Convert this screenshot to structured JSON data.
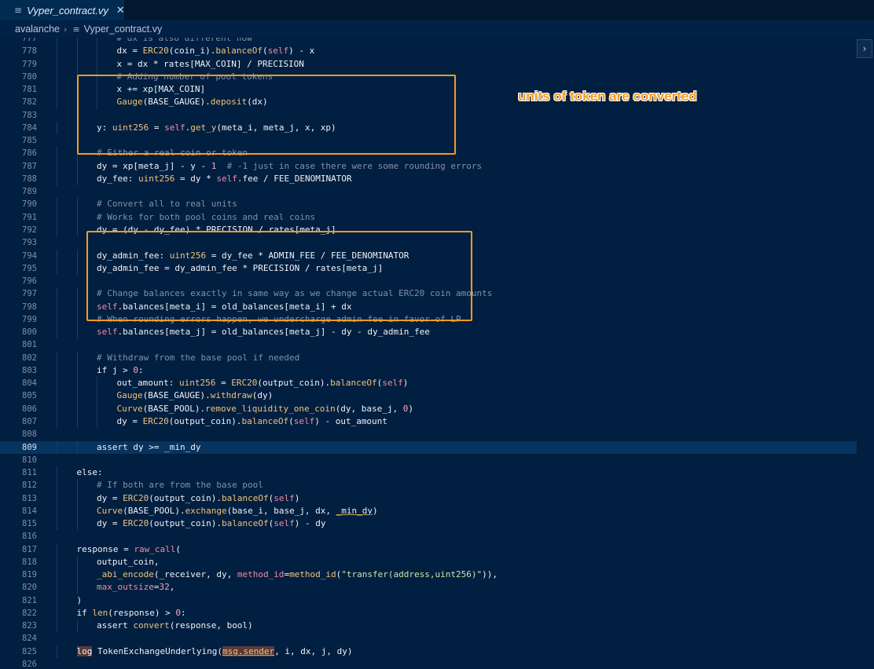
{
  "tab": {
    "icon": "≡",
    "label": "Vyper_contract.vy",
    "close": "✕"
  },
  "breadcrumb": {
    "folder": "avalanche",
    "separator": "›",
    "icon": "≡",
    "file": "Vyper_contract.vy"
  },
  "annotation": {
    "text": "units of token are converted"
  },
  "scroll_button": {
    "label": "›"
  },
  "code_lines": [
    {
      "n": "777",
      "i": 3,
      "segs": [
        [
          "c",
          "# dx is also different now"
        ]
      ]
    },
    {
      "n": "778",
      "i": 3,
      "segs": [
        [
          "k",
          "dx = "
        ],
        [
          "f",
          "ERC20"
        ],
        [
          "k",
          "(coin_i)."
        ],
        [
          "f",
          "balanceOf"
        ],
        [
          "k",
          "("
        ],
        [
          "s",
          "self"
        ],
        [
          "k",
          ") "
        ],
        [
          "o",
          "-"
        ],
        [
          "k",
          " x"
        ]
      ]
    },
    {
      "n": "779",
      "i": 3,
      "segs": [
        [
          "k",
          "x = dx "
        ],
        [
          "o",
          "*"
        ],
        [
          "k",
          " rates[MAX_COIN] "
        ],
        [
          "o",
          "/"
        ],
        [
          "k",
          " PRECISION"
        ]
      ]
    },
    {
      "n": "780",
      "i": 3,
      "segs": [
        [
          "c",
          "# Adding number of pool tokens"
        ]
      ]
    },
    {
      "n": "781",
      "i": 3,
      "segs": [
        [
          "k",
          "x += xp[MAX_COIN]"
        ]
      ]
    },
    {
      "n": "782",
      "i": 3,
      "segs": [
        [
          "f",
          "Gauge"
        ],
        [
          "k",
          "(BASE_GAUGE)."
        ],
        [
          "f",
          "deposit"
        ],
        [
          "k",
          "(dx)"
        ]
      ]
    },
    {
      "n": "783",
      "i": 0,
      "segs": []
    },
    {
      "n": "784",
      "i": 2,
      "segs": [
        [
          "k",
          "y: "
        ],
        [
          "t",
          "uint256"
        ],
        [
          "k",
          " = "
        ],
        [
          "s",
          "self"
        ],
        [
          "k",
          "."
        ],
        [
          "f",
          "get_y"
        ],
        [
          "k",
          "(meta_i, meta_j, x, xp)"
        ]
      ]
    },
    {
      "n": "785",
      "i": 0,
      "segs": []
    },
    {
      "n": "786",
      "i": 2,
      "segs": [
        [
          "c",
          "# Either a real coin or token"
        ]
      ]
    },
    {
      "n": "787",
      "i": 2,
      "segs": [
        [
          "k",
          "dy = xp[meta_j] "
        ],
        [
          "o",
          "-"
        ],
        [
          "k",
          " y "
        ],
        [
          "o",
          "-"
        ],
        [
          "k",
          " "
        ],
        [
          "n",
          "1"
        ],
        [
          "k",
          "  "
        ],
        [
          "c",
          "# -1 just in case there were some rounding errors"
        ]
      ]
    },
    {
      "n": "788",
      "i": 2,
      "segs": [
        [
          "k",
          "dy_fee: "
        ],
        [
          "t",
          "uint256"
        ],
        [
          "k",
          " = dy "
        ],
        [
          "o",
          "*"
        ],
        [
          "k",
          " "
        ],
        [
          "s",
          "self"
        ],
        [
          "k",
          ".fee "
        ],
        [
          "o",
          "/"
        ],
        [
          "k",
          " FEE_DENOMINATOR"
        ]
      ]
    },
    {
      "n": "789",
      "i": 0,
      "segs": []
    },
    {
      "n": "790",
      "i": 2,
      "segs": [
        [
          "c",
          "# Convert all to real units"
        ]
      ]
    },
    {
      "n": "791",
      "i": 2,
      "segs": [
        [
          "c",
          "# Works for both pool coins and real coins"
        ]
      ]
    },
    {
      "n": "792",
      "i": 2,
      "segs": [
        [
          "k",
          "dy = (dy "
        ],
        [
          "o",
          "-"
        ],
        [
          "k",
          " dy_fee) "
        ],
        [
          "o",
          "*"
        ],
        [
          "k",
          " PRECISION "
        ],
        [
          "o",
          "/"
        ],
        [
          "k",
          " rates[meta_j]"
        ]
      ]
    },
    {
      "n": "793",
      "i": 0,
      "segs": []
    },
    {
      "n": "794",
      "i": 2,
      "segs": [
        [
          "k",
          "dy_admin_fee: "
        ],
        [
          "t",
          "uint256"
        ],
        [
          "k",
          " = dy_fee "
        ],
        [
          "o",
          "*"
        ],
        [
          "k",
          " ADMIN_FEE "
        ],
        [
          "o",
          "/"
        ],
        [
          "k",
          " FEE_DENOMINATOR"
        ]
      ]
    },
    {
      "n": "795",
      "i": 2,
      "segs": [
        [
          "k",
          "dy_admin_fee = dy_admin_fee "
        ],
        [
          "o",
          "*"
        ],
        [
          "k",
          " PRECISION "
        ],
        [
          "o",
          "/"
        ],
        [
          "k",
          " rates[meta_j]"
        ]
      ]
    },
    {
      "n": "796",
      "i": 0,
      "segs": []
    },
    {
      "n": "797",
      "i": 2,
      "segs": [
        [
          "c",
          "# Change balances exactly in same way as we change actual ERC20 coin amounts"
        ]
      ]
    },
    {
      "n": "798",
      "i": 2,
      "segs": [
        [
          "s",
          "self"
        ],
        [
          "k",
          ".balances[meta_i] = old_balances[meta_i] + dx"
        ]
      ]
    },
    {
      "n": "799",
      "i": 2,
      "segs": [
        [
          "c",
          "# When rounding errors happen, we undercharge admin fee in favor of LP"
        ]
      ]
    },
    {
      "n": "800",
      "i": 2,
      "segs": [
        [
          "s",
          "self"
        ],
        [
          "k",
          ".balances[meta_j] = old_balances[meta_j] "
        ],
        [
          "o",
          "-"
        ],
        [
          "k",
          " dy "
        ],
        [
          "o",
          "-"
        ],
        [
          "k",
          " dy_admin_fee"
        ]
      ]
    },
    {
      "n": "801",
      "i": 0,
      "segs": []
    },
    {
      "n": "802",
      "i": 2,
      "segs": [
        [
          "c",
          "# Withdraw from the base pool if needed"
        ]
      ]
    },
    {
      "n": "803",
      "i": 2,
      "segs": [
        [
          "k",
          "if j > "
        ],
        [
          "n",
          "0"
        ],
        [
          "k",
          ":"
        ]
      ]
    },
    {
      "n": "804",
      "i": 3,
      "segs": [
        [
          "k",
          "out_amount: "
        ],
        [
          "t",
          "uint256"
        ],
        [
          "k",
          " = "
        ],
        [
          "f",
          "ERC20"
        ],
        [
          "k",
          "(output_coin)."
        ],
        [
          "f",
          "balanceOf"
        ],
        [
          "k",
          "("
        ],
        [
          "s",
          "self"
        ],
        [
          "k",
          ")"
        ]
      ]
    },
    {
      "n": "805",
      "i": 3,
      "segs": [
        [
          "f",
          "Gauge"
        ],
        [
          "k",
          "(BASE_GAUGE)."
        ],
        [
          "f",
          "withdraw"
        ],
        [
          "k",
          "(dy)"
        ]
      ]
    },
    {
      "n": "806",
      "i": 3,
      "segs": [
        [
          "f",
          "Curve"
        ],
        [
          "k",
          "(BASE_POOL)."
        ],
        [
          "f",
          "remove_liquidity_one_coin"
        ],
        [
          "k",
          "(dy, base_j, "
        ],
        [
          "n",
          "0"
        ],
        [
          "k",
          ")"
        ]
      ]
    },
    {
      "n": "807",
      "i": 3,
      "segs": [
        [
          "k",
          "dy = "
        ],
        [
          "f",
          "ERC20"
        ],
        [
          "k",
          "(output_coin)."
        ],
        [
          "f",
          "balanceOf"
        ],
        [
          "k",
          "("
        ],
        [
          "s",
          "self"
        ],
        [
          "k",
          ") "
        ],
        [
          "o",
          "-"
        ],
        [
          "k",
          " out_amount"
        ]
      ]
    },
    {
      "n": "808",
      "i": 0,
      "segs": []
    },
    {
      "n": "809",
      "i": 2,
      "cur": true,
      "segs": [
        [
          "k",
          "assert dy >= _min_dy"
        ]
      ]
    },
    {
      "n": "810",
      "i": 0,
      "segs": []
    },
    {
      "n": "811",
      "i": 1,
      "segs": [
        [
          "k",
          "else:"
        ]
      ]
    },
    {
      "n": "812",
      "i": 2,
      "segs": [
        [
          "c",
          "# If both are from the base pool"
        ]
      ]
    },
    {
      "n": "813",
      "i": 2,
      "segs": [
        [
          "k",
          "dy = "
        ],
        [
          "f",
          "ERC20"
        ],
        [
          "k",
          "(output_coin)."
        ],
        [
          "f",
          "balanceOf"
        ],
        [
          "k",
          "("
        ],
        [
          "s",
          "self"
        ],
        [
          "k",
          ")"
        ]
      ]
    },
    {
      "n": "814",
      "i": 2,
      "segs": [
        [
          "f",
          "Curve"
        ],
        [
          "k",
          "(BASE_POOL)."
        ],
        [
          "f",
          "exchange"
        ],
        [
          "k",
          "(base_i, base_j, dx, "
        ],
        [
          "u",
          "_min_dy"
        ],
        [
          "k",
          ")"
        ]
      ]
    },
    {
      "n": "815",
      "i": 2,
      "segs": [
        [
          "k",
          "dy = "
        ],
        [
          "f",
          "ERC20"
        ],
        [
          "k",
          "(output_coin)."
        ],
        [
          "f",
          "balanceOf"
        ],
        [
          "k",
          "("
        ],
        [
          "s",
          "self"
        ],
        [
          "k",
          ") "
        ],
        [
          "o",
          "-"
        ],
        [
          "k",
          " dy"
        ]
      ]
    },
    {
      "n": "816",
      "i": 0,
      "segs": []
    },
    {
      "n": "817",
      "i": 1,
      "segs": [
        [
          "k",
          "response = "
        ],
        [
          "s",
          "raw_call"
        ],
        [
          "k",
          "("
        ]
      ]
    },
    {
      "n": "818",
      "i": 2,
      "segs": [
        [
          "k",
          "output_coin,"
        ]
      ]
    },
    {
      "n": "819",
      "i": 2,
      "segs": [
        [
          "f",
          "_abi_encode"
        ],
        [
          "k",
          "(_receiver, dy, "
        ],
        [
          "s",
          "method_id"
        ],
        [
          "k",
          "="
        ],
        [
          "f",
          "method_id"
        ],
        [
          "k",
          "("
        ],
        [
          "st",
          "\"transfer(address,uint256)\""
        ],
        [
          "k",
          ")),"
        ]
      ]
    },
    {
      "n": "820",
      "i": 2,
      "segs": [
        [
          "s",
          "max_outsize"
        ],
        [
          "k",
          "="
        ],
        [
          "n",
          "32"
        ],
        [
          "k",
          ","
        ]
      ]
    },
    {
      "n": "821",
      "i": 1,
      "segs": [
        [
          "k",
          ")"
        ]
      ]
    },
    {
      "n": "822",
      "i": 1,
      "segs": [
        [
          "k",
          "if "
        ],
        [
          "f",
          "len"
        ],
        [
          "k",
          "(response) > "
        ],
        [
          "n",
          "0"
        ],
        [
          "k",
          ":"
        ]
      ]
    },
    {
      "n": "823",
      "i": 2,
      "segs": [
        [
          "k",
          "assert "
        ],
        [
          "f",
          "convert"
        ],
        [
          "k",
          "(response, bool)"
        ]
      ]
    },
    {
      "n": "824",
      "i": 0,
      "segs": []
    },
    {
      "n": "825",
      "i": 1,
      "segs": [
        [
          "log",
          "log"
        ],
        [
          "k",
          " TokenExchangeUnderlying("
        ],
        [
          "sender",
          "msg.sender"
        ],
        [
          "k",
          ", i, dx, j, dy)"
        ]
      ]
    },
    {
      "n": "826",
      "i": 0,
      "segs": []
    }
  ]
}
